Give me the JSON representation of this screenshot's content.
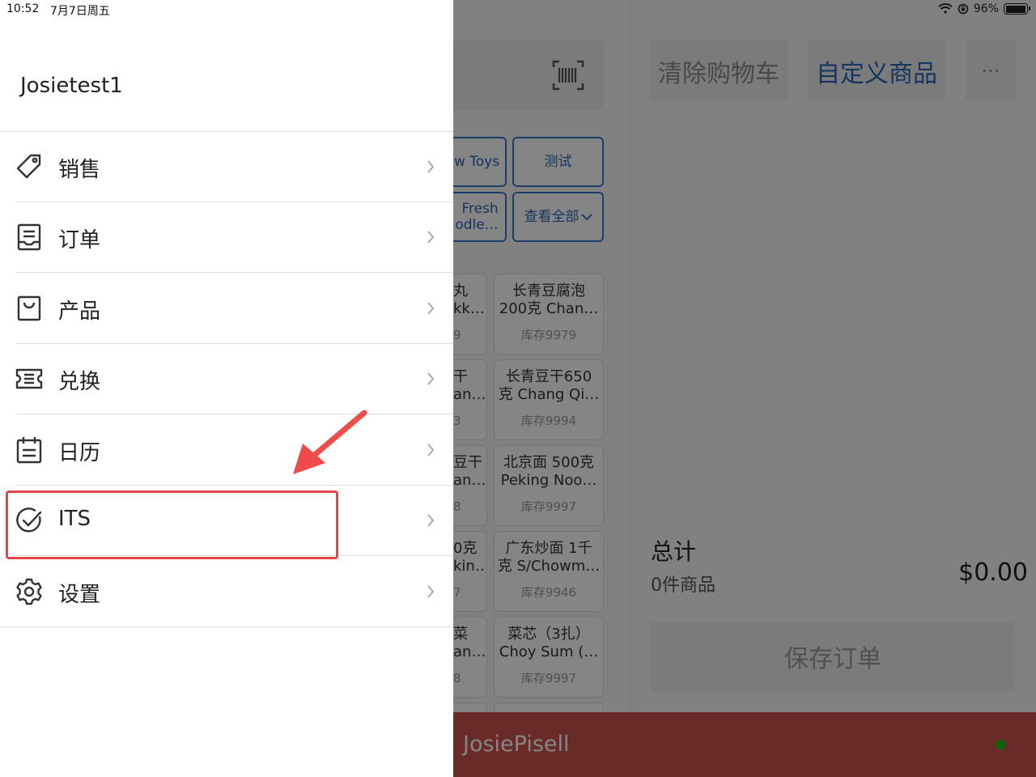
{
  "status_bar": {
    "time": "10:52",
    "date": "7月7日周五",
    "battery": "96%",
    "battery_level": 0.96
  },
  "drawer": {
    "username": "Josietest1",
    "menu": [
      {
        "label": "销售",
        "icon": "tag-icon"
      },
      {
        "label": "订单",
        "icon": "receipt-icon"
      },
      {
        "label": "产品",
        "icon": "shopping-bag-icon"
      },
      {
        "label": "兑换",
        "icon": "ticket-icon"
      },
      {
        "label": "日历",
        "icon": "calendar-icon"
      },
      {
        "label": "ITS",
        "icon": "check-circle-icon"
      },
      {
        "label": "设置",
        "icon": "gear-icon"
      }
    ]
  },
  "background": {
    "clear_cart": "清除购物车",
    "custom_product": "自定义商品",
    "more": "···",
    "categories": [
      "w Toys",
      "测试",
      "Fresh\nodle…",
      "查看全部"
    ],
    "products": [
      {
        "name1": "长青豆腐泡",
        "name2": "200克 Chan…",
        "stock": "库存9979"
      },
      {
        "name1": "长青豆干650",
        "name2": "克 Chang Qi…",
        "stock": "库存9994"
      },
      {
        "name1": "北京面 500克",
        "name2": "Peking Noo…",
        "stock": "库存9997"
      },
      {
        "name1": "广东炒面 1千",
        "name2": "克 S/Chowm…",
        "stock": "库存9946"
      },
      {
        "name1": "菜芯（3扎）",
        "name2": "Choy Sum (…",
        "stock": "库存9997"
      }
    ],
    "partial_products": [
      {
        "l1": "丸",
        "l2": "kk…",
        "l3": "9"
      },
      {
        "l1": "干",
        "l2": "an…",
        "l3": "3"
      },
      {
        "l1": "豆干",
        "l2": "an…",
        "l3": "8"
      },
      {
        "l1": "0克",
        "l2": "kin…",
        "l3": "7"
      },
      {
        "l1": "菜",
        "l2": "an…",
        "l3": "8"
      }
    ],
    "total_label": "总计",
    "item_count": "0件商品",
    "total_amount": "$0.00",
    "save_order": "保存订单",
    "store_name": "JosiePisell"
  },
  "colors": {
    "accent": "#2a67b8",
    "highlight": "#e6434a",
    "footer": "#c9534c",
    "online": "#1cc01c"
  }
}
